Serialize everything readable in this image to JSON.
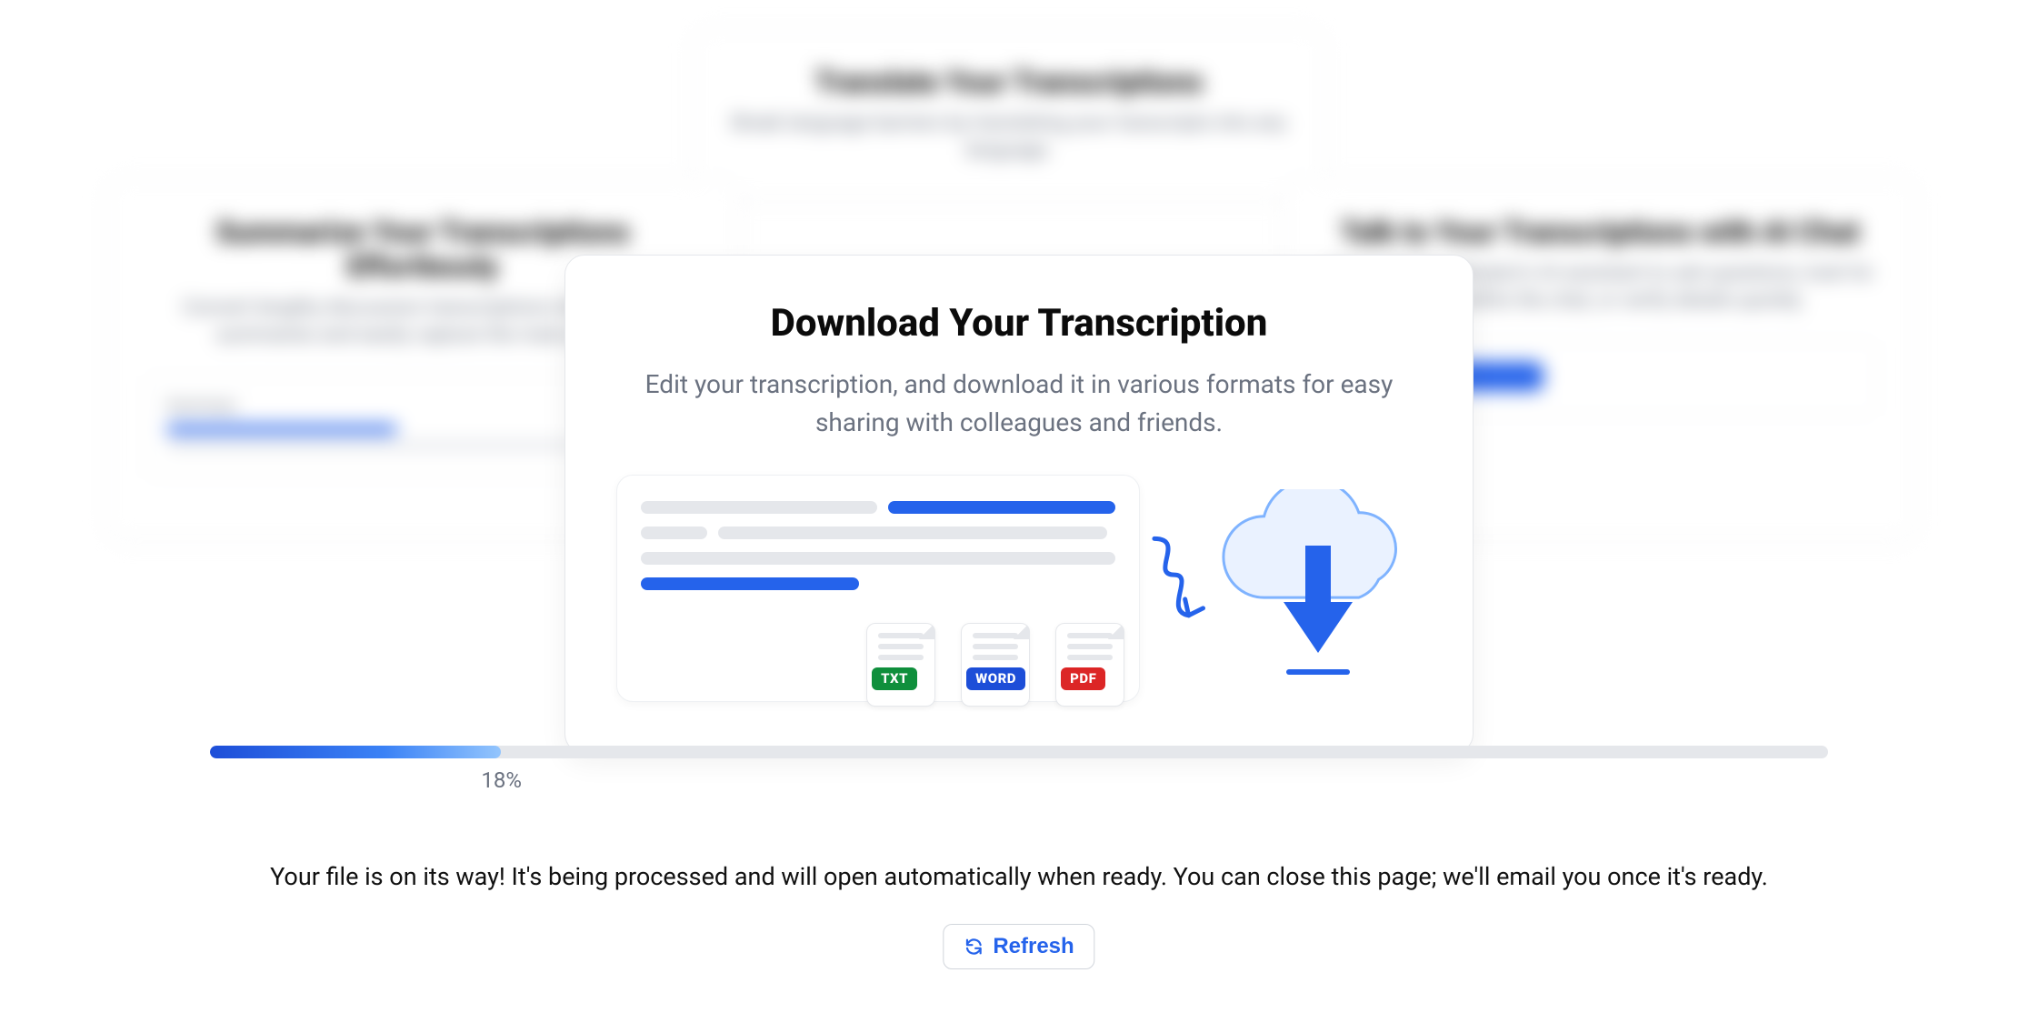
{
  "bg_cards": {
    "top": {
      "title": "Translate Your Transcriptions",
      "desc": "Break language barriers by translating your transcripts into any language."
    },
    "left": {
      "title": "Summarize Your Transcriptions Effortlessly",
      "desc": "Convert lengthy discussion transcriptions into concise summaries and easily capture the main points.",
      "mock_title": "Summary"
    },
    "right": {
      "title": "Talk to Your Transcriptions with AI Chat",
      "desc": "Chat with Transkriptor's AI assistant to ask questions, look for details within the chat, or verify details quickly."
    }
  },
  "card": {
    "title": "Download Your Transcription",
    "subtitle": "Edit your transcription, and download it in various formats for easy sharing with colleagues and friends.",
    "formats": {
      "txt": "TXT",
      "word": "WORD",
      "pdf": "PDF"
    }
  },
  "progress": {
    "percent": 18,
    "percent_label": "18%"
  },
  "status": {
    "message": "Your file is on its way! It's being processed and will open automatically when ready. You can close this page; we'll email you once it's ready."
  },
  "actions": {
    "refresh": "Refresh"
  }
}
